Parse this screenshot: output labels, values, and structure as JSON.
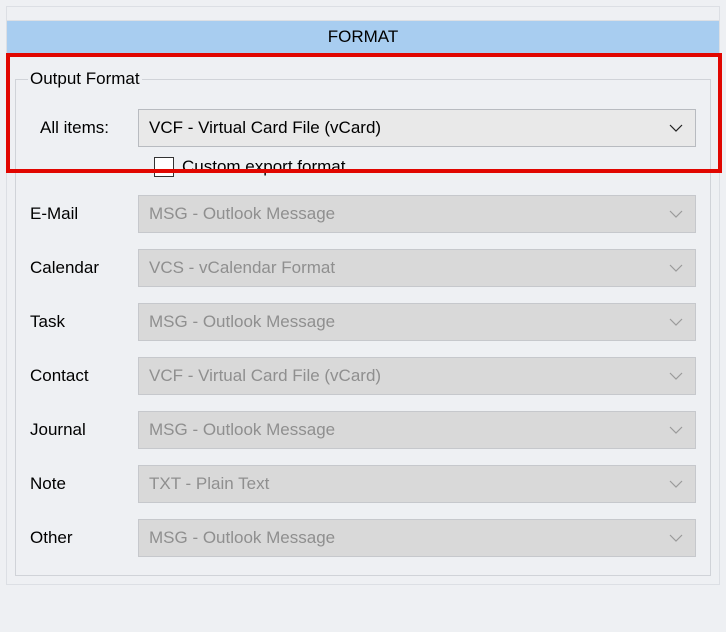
{
  "header": {
    "title": "FORMAT"
  },
  "groupbox": {
    "legend": "Output Format"
  },
  "all_items": {
    "label": "All items:",
    "value": "VCF - Virtual Card File (vCard)"
  },
  "custom_checkbox": {
    "label": "Custom export format",
    "checked": false
  },
  "rows": {
    "email": {
      "label": "E-Mail",
      "value": "MSG - Outlook Message"
    },
    "calendar": {
      "label": "Calendar",
      "value": "VCS - vCalendar Format"
    },
    "task": {
      "label": "Task",
      "value": "MSG - Outlook Message"
    },
    "contact": {
      "label": "Contact",
      "value": "VCF - Virtual Card File (vCard)"
    },
    "journal": {
      "label": "Journal",
      "value": "MSG - Outlook Message"
    },
    "note": {
      "label": "Note",
      "value": "TXT - Plain Text"
    },
    "other": {
      "label": "Other",
      "value": "MSG - Outlook Message"
    }
  }
}
